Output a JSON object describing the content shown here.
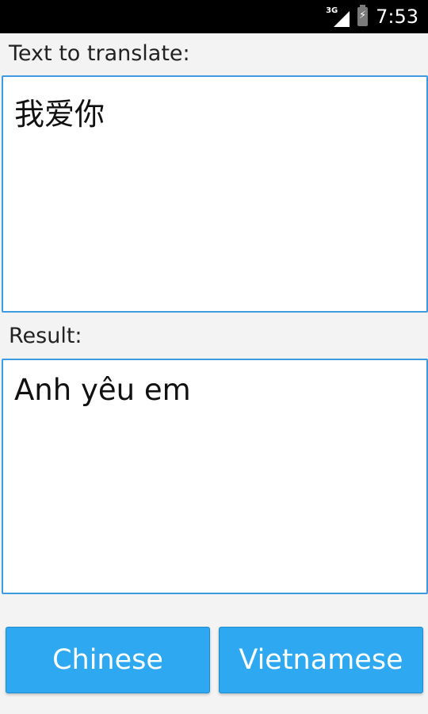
{
  "status_bar": {
    "network": "3G",
    "battery_glyph": "⚡",
    "time": "7:53"
  },
  "input": {
    "label": "Text to translate:",
    "value": "我爱你"
  },
  "result": {
    "label": "Result:",
    "value": "Anh yêu em"
  },
  "buttons": {
    "source_language": "Chinese",
    "target_language": "Vietnamese"
  },
  "colors": {
    "accent": "#2ea8f0",
    "field_border": "#3f9be0",
    "background": "#f3f3f3"
  }
}
